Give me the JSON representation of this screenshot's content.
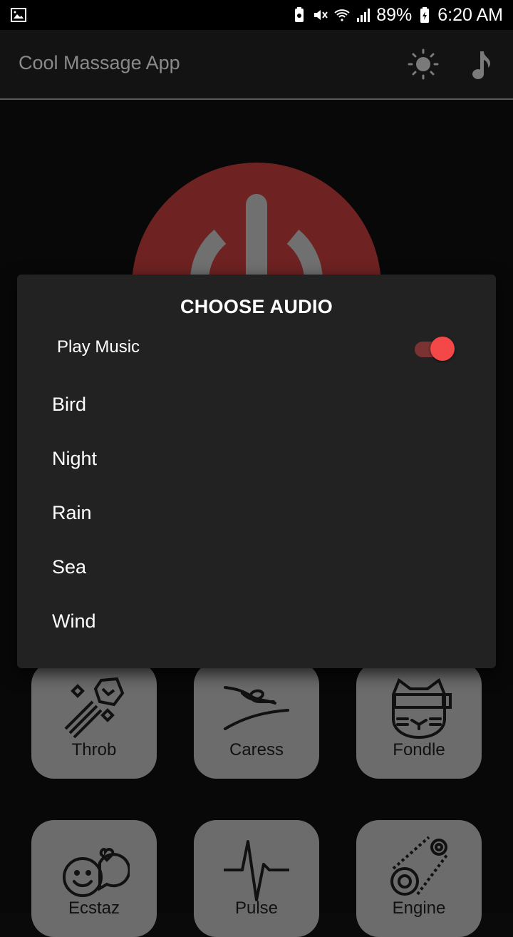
{
  "status_bar": {
    "battery": "89%",
    "time": "6:20 AM",
    "icons": [
      "image-icon",
      "battery-saver-icon",
      "mute-icon",
      "wifi-icon",
      "signal-icon",
      "battery-charging-icon"
    ]
  },
  "app_bar": {
    "title": "Cool Massage App",
    "icons": [
      "brightness-icon",
      "music-note-icon"
    ]
  },
  "main": {
    "power_button_icon": "power-icon",
    "modes": [
      {
        "label": "Throb",
        "icon": "meteor-icon"
      },
      {
        "label": "Caress",
        "icon": "hand-caress-icon"
      },
      {
        "label": "Fondle",
        "icon": "cat-vr-icon"
      },
      {
        "label": "Ecstaz",
        "icon": "faces-heart-icon"
      },
      {
        "label": "Pulse",
        "icon": "pulse-icon"
      },
      {
        "label": "Engine",
        "icon": "engine-gear-icon"
      }
    ]
  },
  "dialog": {
    "title": "CHOOSE AUDIO",
    "play_music_label": "Play Music",
    "play_music_on": true,
    "options": [
      "Bird",
      "Night",
      "Rain",
      "Sea",
      "Wind"
    ]
  },
  "colors": {
    "accent": "#f44848",
    "power_circle": "#6e2222",
    "dialog_bg": "#222222",
    "tile_bg": "#6c6c6c"
  }
}
